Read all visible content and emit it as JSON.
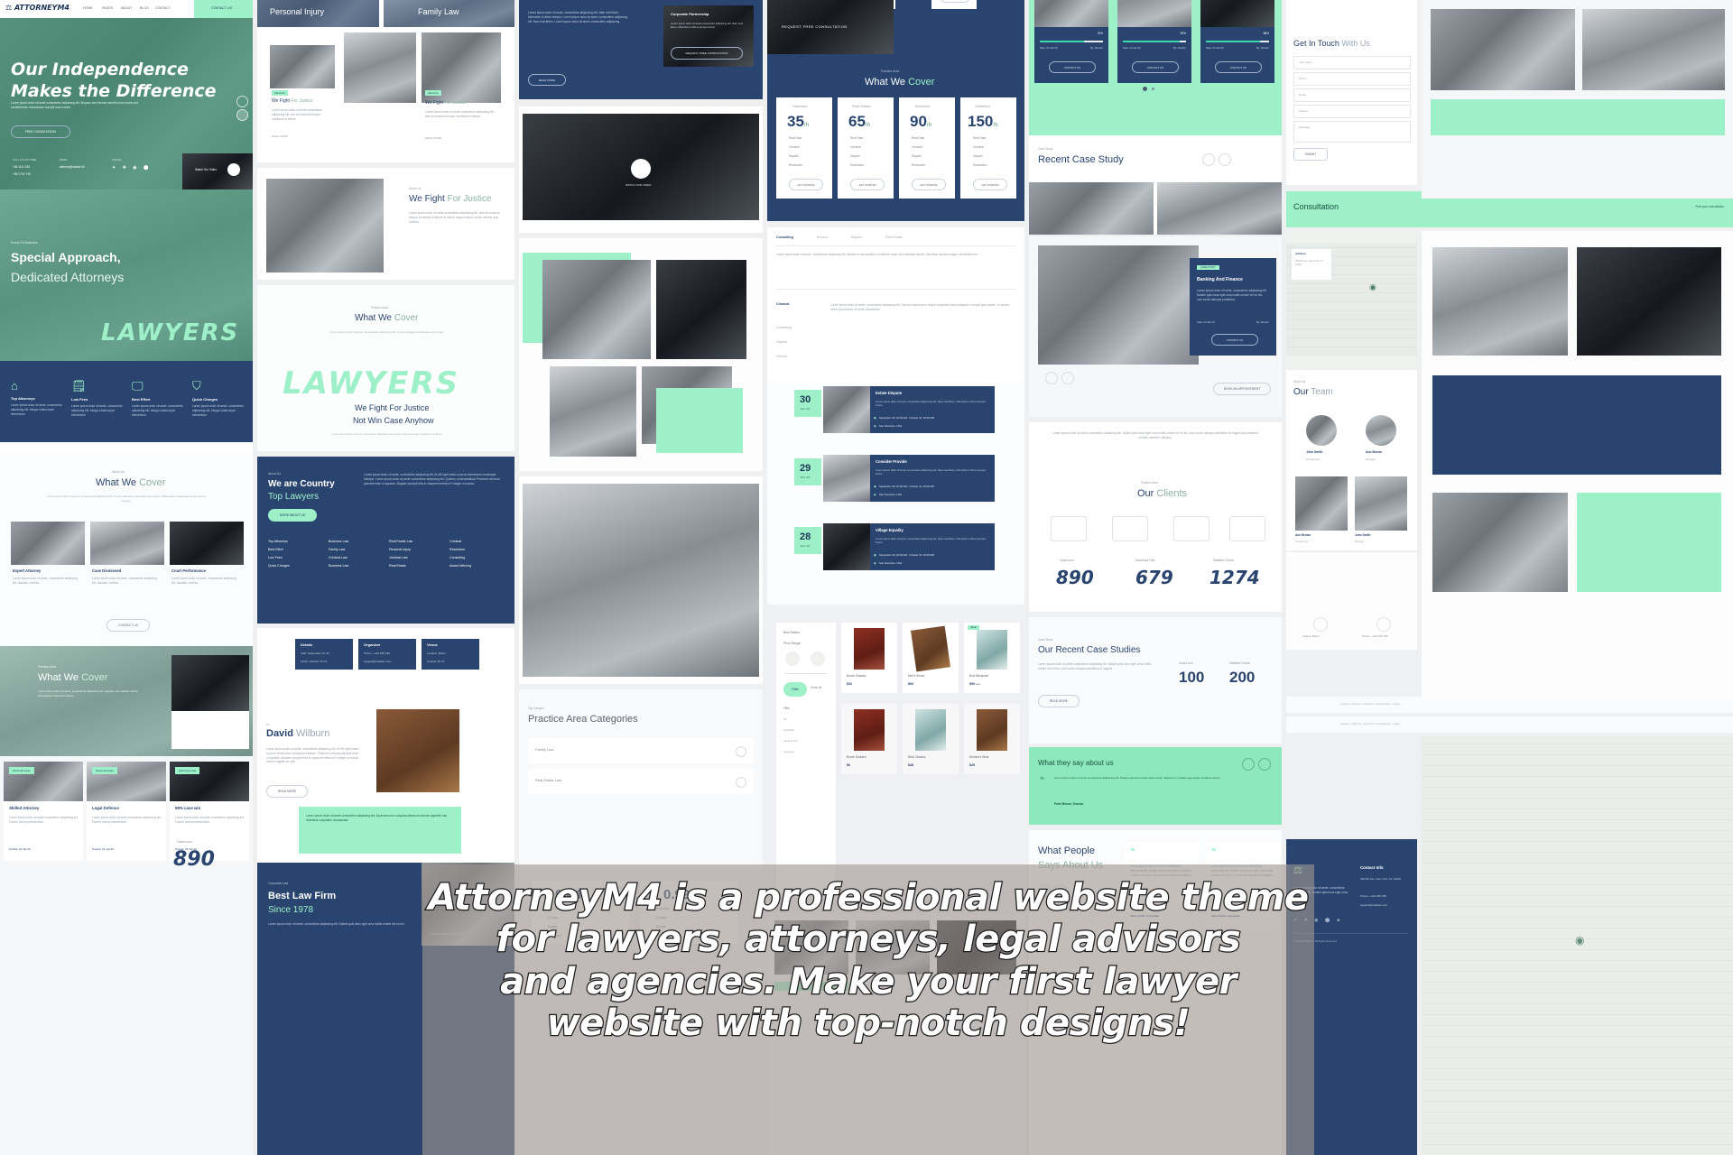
{
  "meta": {
    "theme_name": "AttorneyM4",
    "accent_mint": "#9ef0c9",
    "accent_navy": "#29446e"
  },
  "overlay": {
    "lines": [
      "AttorneyM4 is a professional website theme",
      "for lawyers, attorneys, legal advisors",
      "and agencies. Make your first lawyer",
      "website with top-notch designs!"
    ]
  },
  "header": {
    "logo": "ATTORNEYM4",
    "nav": [
      "HOME",
      "PAGES",
      "ABOUT",
      "BLOG",
      "CONTACT"
    ],
    "cta": "CONTACT US"
  },
  "hero": {
    "title_line1": "Our Independence",
    "title_line2": "Makes the Difference",
    "paragraph": "Lorem ipsum dolor sit amet consectetur adipiscing elit. Aliquam sed lobortis lobortis urna mauris sed condimentum recusandae suscipit urna mauris.",
    "button": "FREE CONSULTATION",
    "contact_label": "CALL US ANYTIME",
    "phone1": "+65 1111 345",
    "phone2": "+65 2715 745",
    "email_label": "EMAIL",
    "email": "attorney@mailer.tld",
    "social_label": "SOCIAL",
    "video_label": "Watch Our Video"
  },
  "special": {
    "eyebrow": "Focus On Business",
    "title_line1": "Special Approach,",
    "title_line2": "Dedicated Attorneys",
    "brush_word": "LAWYERS"
  },
  "features": [
    {
      "icon": "home-icon",
      "title": "Top Attorneys",
      "text": "Lorem ipsum dolor sit amet, consectetur adipiscing elit, integur ullamcorper elementum"
    },
    {
      "icon": "document-icon",
      "title": "Low Fees",
      "text": "Lorem ipsum dolor sit amet, consectetur adipiscing elit, integur ullamcorper elementum"
    },
    {
      "icon": "monitor-icon",
      "title": "Best Effort",
      "text": "Lorem ipsum dolor sit amet, consectetur adipiscing elit, integur ullamcorper elementum"
    },
    {
      "icon": "shield-icon",
      "title": "Quick Charges",
      "text": "Lorem ipsum dolor sit amet, consectetur adipiscing elit, integur ullamcorper elementum"
    }
  ],
  "what_we_cover_left": {
    "eyebrow": "About Us",
    "title_plain": "What We",
    "title_accent": "Cover",
    "subtitle": "Lorem ipsum dolor sit amet, consectetur adipiscing elit. In justo aliquam scelerisque accumsan. Malesuada malesuada accumsan eu tempus.",
    "cards": [
      {
        "title": "Expert Attorney",
        "text": "Lorem ipsum dolor sit amet, consectetur adipiscing elit, blandits, pretium"
      },
      {
        "title": "Case Dismissed",
        "text": "Lorem ipsum dolor sit amet, consectetur adipiscing elit, blandits, pretium"
      },
      {
        "title": "Court Performance",
        "text": "Lorem ipsum dolor sit amet, consectetur adipiscing elit, blandits, pretium"
      }
    ],
    "button": "CONTACT US"
  },
  "cover_bottom_left": {
    "eyebrow": "Practice Area",
    "title_plain": "What We",
    "title_accent": "Cover",
    "text": "Lorem ipsum dolor sit amet, consectetur adipiscing elit. Aperiam eos velitatis minus, accusantium doloribus ratione"
  },
  "news_cards": [
    {
      "tag": "Personal Injury",
      "title": "Skilled Attorney",
      "text": "Lorem ipsum dolor sit amet consectetur adipiscing elit. Facere dolore praesentium.",
      "date": "Posted: 23 Jan'19"
    },
    {
      "tag": "Personal Injury",
      "title": "Legal Defence",
      "text": "Lorem ipsum dolor sit amet consectetur adipiscing elit. Facere dolore praesentium.",
      "date": "Posted: 23 Jan'19"
    },
    {
      "tag": "Attorneys Law",
      "title": "99% case win",
      "text": "Lorem ipsum dolor sit amet consectetur adipiscing elit. Facere dolore praesentium.",
      "date": "Posted: 23 Jan'19"
    }
  ],
  "cases_won": {
    "label": "Cases won",
    "value": "890"
  },
  "col2": {
    "practice_a": "Personal Injury",
    "practice_b": "Family Law",
    "we_fight_eyebrow": "About Us",
    "we_fight_plain": "We Fight",
    "we_fight_accent": "For Justice",
    "we_fight_text": "Lorem ipsum dolor sit amet consectetur adipiscing elit. Sed do eiusmod tempor incididunt ut labore et dolore magna aliqua, minim veniam quis nostrud.",
    "read_more": "READ MORE",
    "cover_eyebrow": "Practice Area",
    "cover_plain": "What We",
    "cover_accent": "Cover",
    "cover_text": "Lorem ipsum dolor sit amet, consectetur adipiscing elit. In justo aliquam scelerisque accumsan.",
    "brush_word": "LAWYERS",
    "brush_sub1": "We Fight For Justice",
    "brush_sub2": "Not Win Case Anyhow",
    "brush_note": "Lorem ipsum dolor sit amet, consectetur adipiscing elit, sed do eiusmod tempor incididunt ut labore.",
    "country_eyebrow": "About Us",
    "country_line1": "We are Country",
    "country_line2": "Top Lawyers",
    "country_btn": "MORE ABOUT US",
    "country_text": "Lorem ipsum dolor sit amet, consectetur adipiscing elit. At elit eget lectus a purus elementum consequat tristique. Lorem ipsum dolor sit amet consectetur adipiscing elit. Quisem, necessitatibus! Praesent vehicula placerat enim ut egestas. Aliquam suscipit felis in massa fermentum? Integer ut massa.",
    "tag_grid": [
      [
        "Top Attorneys",
        "Business Law",
        "Real Estate Law",
        "Criminal"
      ],
      [
        "Best Effort",
        "Family Law",
        "Personal Injury",
        "Resolution"
      ],
      [
        "Low Fees",
        "Criminal Law",
        "Juridical Law",
        "Consulting"
      ],
      [
        "Quick Charges",
        "Business Law",
        "Real Estate",
        "Award Winning"
      ]
    ],
    "event_boxes": [
      {
        "title": "Details",
        "line1": "Start: September 10 '20",
        "line2": "Finish: October 15 '21"
      },
      {
        "title": "Organizer",
        "line1": "Phone: +123 456 789",
        "line2": "support@mailster.com"
      },
      {
        "title": "Venue",
        "line1": "Location: Berlin",
        "line2": "October 19' 21"
      }
    ],
    "attorney_name_plain": "David",
    "attorney_name_accent": "Wilburn",
    "attorney_text": "Lorem ipsum dolor sit amet, consectetur adipiscing elit. At elit eget lectus a purus elementum consequat tristique. Praesent vehicula placerat enim ut egestas. Aliquam suscipit felis in massa fermentum? Integer ut massa nulla in sagittis ac odio.",
    "attorney_btn": "READ MORE",
    "mint_note": "Lorem ipsum dolor sit amet consectetur adipiscing elit. Asperiores eos voluptas deserunt nostrum sapiente nisi, molestias voluptates recusandae.",
    "corporate_eyebrow": "Corporate Law",
    "corporate_title": "Best Law Firm",
    "corporate_sub": "Since 1978",
    "corporate_text": "Lorem ipsum dolor sit amet, consectetur adipiscing elit. Nullam quis risus eget urna mollis ornare vel eu leo."
  },
  "col3": {
    "video_panel_title": "REQUEST FREE CONSULTATION",
    "video_btn": "REQUEST FREE CONSULTATION",
    "read_more": "READ MORE",
    "practice_eyebrow": "Top Lawyers",
    "practice_title": "Practice Area Categories",
    "practice_items": [
      "Family Law",
      "Real Estate Law"
    ],
    "stats": [
      {
        "value": "0.44",
        "unit": "/h",
        "items": [
          "Real Data",
          "Criminal",
          "Dispute",
          "Resolution"
        ]
      },
      {
        "value": "0.99",
        "unit": "/h",
        "items": [
          "Real Data",
          "Criminal",
          "Dispute",
          "Resolution"
        ]
      }
    ]
  },
  "col4": {
    "pricing_eyebrow": "Practice Area",
    "pricing_plain": "What We",
    "pricing_accent": "Cover",
    "plans": [
      {
        "name": "Standard",
        "price": "35",
        "unit": "/h",
        "features": [
          "Real Data",
          "Criminal",
          "Dispute",
          "Resolution"
        ],
        "button": "GET STARTED"
      },
      {
        "name": "Real Estate",
        "price": "65",
        "unit": "/h",
        "features": [
          "Real Data",
          "Criminal",
          "Dispute",
          "Resolution"
        ],
        "button": "GET STARTED"
      },
      {
        "name": "Business",
        "price": "90",
        "unit": "/h",
        "features": [
          "Real Data",
          "Criminal",
          "Dispute",
          "Resolution"
        ],
        "button": "GET STARTED"
      },
      {
        "name": "Unlimited",
        "price": "150",
        "unit": "/h",
        "features": [
          "Real Data",
          "Criminal",
          "Dispute",
          "Resolution"
        ],
        "button": "GET STARTED"
      }
    ],
    "tabs": [
      "Consulting",
      "Divorce",
      "Dispute",
      "Real Estate"
    ],
    "tab_text": "Lorem ipsum dolor sit amet, consectetur adipiscing elit. Beatae et accusantium incididunt neque sed doloribus ipsum, doloribus dolorem magni exercitationem.",
    "accordion": [
      {
        "label": "Criminal",
        "open": true,
        "text": "Lorem ipsum dolor sit amet, consectetur adipiscing elit. Dolores ullamcorper neque voluptates ipsum aliquam, corrupti quis sapien, ut ratione, lorem ipsum dolor sit amet consectetur."
      },
      {
        "label": "Consulting",
        "open": false
      },
      {
        "label": "Dispute",
        "open": false
      },
      {
        "label": "Divorce",
        "open": false
      }
    ],
    "events": [
      {
        "day": "30",
        "month": "Dec '19",
        "title": "Estate Dispute",
        "text": "Lorem ipsum dolor sit amet, consectetur adipiscing elit. Nam erat libero, bibendum in libero tempor, luctus.",
        "date": "September 30, 10:00 AM - October 31, 18:00 PM",
        "place": "San Francisco, USA"
      },
      {
        "day": "29",
        "month": "Dec '19",
        "title": "Consider Provide",
        "text": "Lorem ipsum dolor sit amet, consectetur adipiscing elit. Nam erat libero, bibendum in libero tempor, luctus.",
        "date": "September 30, 10:00 AM - October 31, 18:00 PM",
        "place": "San Francisco, USA"
      },
      {
        "day": "28",
        "month": "Dec '19",
        "title": "Village Equality",
        "text": "Lorem ipsum dolor sit amet, consectetur adipiscing elit. Nam erat libero, bibendum in libero tempor, luctus.",
        "date": "September 30, 10:00 AM - October 31, 18:00 PM",
        "place": "San Francisco, USA"
      }
    ],
    "shop": {
      "best_sellers": "Best Sellers",
      "price_range": "Price Range",
      "filter_btn": "Filter",
      "show_all_btn": "Show all",
      "filter_label": "Filter",
      "filter_options": [
        "All",
        "Available",
        "Hand & Fist",
        "Category"
      ],
      "products": [
        {
          "name": "Brown Glasses",
          "price": "$32"
        },
        {
          "name": "Men's Shoes",
          "price": "$90"
        },
        {
          "name": "Blue Backpack",
          "price": "$90",
          "old": "$44",
          "badge": "SALE"
        }
      ],
      "products_row2": [
        {
          "name": "Brown Glasses",
          "price": "$6"
        },
        {
          "name": "Brick Glasses",
          "price": "$48"
        },
        {
          "name": "Women's Wear",
          "price": "$29"
        }
      ]
    }
  },
  "col5": {
    "case_cards": [
      {
        "percent": "70%",
        "date": "Date: 23 Jan'19",
        "by": "By: Sharfur",
        "button": "CONTACT US"
      },
      {
        "percent": "90%",
        "date": "Date: 23 Jan'19",
        "by": "By: Sharfur",
        "button": "CONTACT US"
      },
      {
        "percent": "86%",
        "date": "Date: 23 Jan'19",
        "by": "By: Sharfur",
        "button": "CONTACT US"
      }
    ],
    "case_study_eyebrow": "Case Study",
    "case_study_title": "Recent Case Study",
    "banking_title": "Banking And Finance",
    "banking_text": "Lorem ipsum dolor sit amet, consectetur adipiscing elit. Nullam quis risus eget urna mollis ornare vel eu leo, cum sociis natoque penatibus.",
    "banking_date": "Date: 23 Jan'19",
    "banking_by": "By: Sharfur",
    "banking_btn": "CONTACT US",
    "banking_badge": "CASE STUDY",
    "appointment_btn": "BOOK AN APPOINTMENT",
    "our_clients_eyebrow": "Practice Area",
    "our_clients_plain": "Our",
    "our_clients_accent": "Clients",
    "counters": [
      {
        "label": "Cases won",
        "value": "890"
      },
      {
        "label": "Download Files",
        "value": "679"
      },
      {
        "label": "Satisfied Clients",
        "value": "1274"
      }
    ],
    "recent_eyebrow": "Case Study",
    "recent_title": "Our Recent Case Studies",
    "recent_text": "Lorem ipsum dolor sit amet consectetur adipiscing elit. Nullam quis risus eget urna mollis ornare vel eu leo, cum sociis natoque penatibus et magnis.",
    "recent_btn": "READ MORE",
    "recent_counters": [
      {
        "label": "Cases won",
        "value": "100"
      },
      {
        "label": "Satisfied Clients",
        "value": "200"
      }
    ],
    "testimonial_mint_title": "What they say about us",
    "testimonial_mint_text": "Lorem ipsum dolor sit amet consectetur adipiscing elit. Nullam sed amet lorem ipsum dolor. Mauris non massa eget lectus vel libero dolore.",
    "testimonial_mint_name": "Peter Brown, Teacher",
    "what_people_plain": "What People",
    "what_people_accent": "Says About Us",
    "quotes": [
      {
        "text": "Lorem ipsum dolor sit amet consectetur adipiscing elit. Nullam quis risus eget urna mollis ornare vel eu leo, cum sociis natoque penatibus.",
        "name": "John Smith, Associate"
      },
      {
        "text": "Lorem ipsum dolor sit amet consectetur adipiscing elit. Nullam quis risus eget urna mollis ornare vel eu leo, cum sociis natoque penatibus.",
        "name": "Jane Smith, Associate"
      }
    ]
  },
  "col6": {
    "get_in_touch_plain": "Get In Touch",
    "get_in_touch_accent": "With Us",
    "form_fields": [
      {
        "placeholder": "Your name"
      },
      {
        "placeholder": "Phone"
      },
      {
        "placeholder": "Email"
      },
      {
        "placeholder": "Subject"
      },
      {
        "placeholder": "Message"
      }
    ],
    "submit_btn": "SUBMIT",
    "consultation_title": "Consultation",
    "consultation_btn": "Free your consultation",
    "map_label": "Map",
    "address_title": "Address",
    "address_line": "236 5th Ave, New York, NY 10001",
    "our_team_eyebrow": "About Us",
    "our_team_plain": "Our",
    "our_team_accent": "Team",
    "team": [
      {
        "name": "John Smith",
        "role": "Programmer"
      },
      {
        "name": "Ann Brown",
        "role": "Manager"
      },
      {
        "name": "Ann Brown",
        "role": "Programmer"
      },
      {
        "name": "John Smith",
        "role": "Manager"
      }
    ],
    "contact_row": [
      {
        "icon": "location-icon",
        "label": "Adress: Berlin"
      },
      {
        "icon": "phone-icon",
        "label": "Phone: +123 456 789"
      }
    ],
    "footer_contact_title": "Contact Info",
    "footer_address": "236 5th Ave, New York, NY 10001",
    "footer_phone": "Phone: +123 456 789",
    "footer_email": "support@mailster.com",
    "footer_copy": "© 2019 Mailberry - All Rights Reserved",
    "tag_lines": [
      "Lawyer  •  Attorney  •  Experts  •  Consultancy  •  Legal",
      "Lawyer  •  Attorney  •  Experts  •  Consultancy  •  Legal"
    ]
  }
}
